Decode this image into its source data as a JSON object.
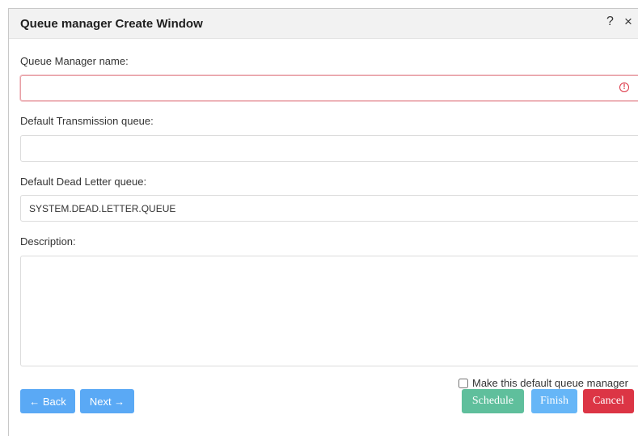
{
  "dialog": {
    "title": "Queue manager Create Window",
    "help_label": "?",
    "close_label": "×"
  },
  "form": {
    "qm_name_label": "Queue Manager name:",
    "qm_name_value": "",
    "qm_name_error_icon": "!",
    "xmit_label": "Default Transmission queue:",
    "xmit_value": "",
    "dlq_label": "Default Dead Letter queue:",
    "dlq_value": "SYSTEM.DEAD.LETTER.QUEUE",
    "description_label": "Description:",
    "description_value": "",
    "default_qm_label": "Make this default queue manager",
    "default_qm_checked": false
  },
  "buttons": {
    "back": "← Back",
    "next": "Next →",
    "schedule": "Schedule",
    "finish": "Finish",
    "cancel": "Cancel"
  },
  "colors": {
    "primary": "#5aa9f5",
    "success": "#5fbf9c",
    "danger": "#dc3545",
    "titlebar": "#f2f2f2"
  }
}
